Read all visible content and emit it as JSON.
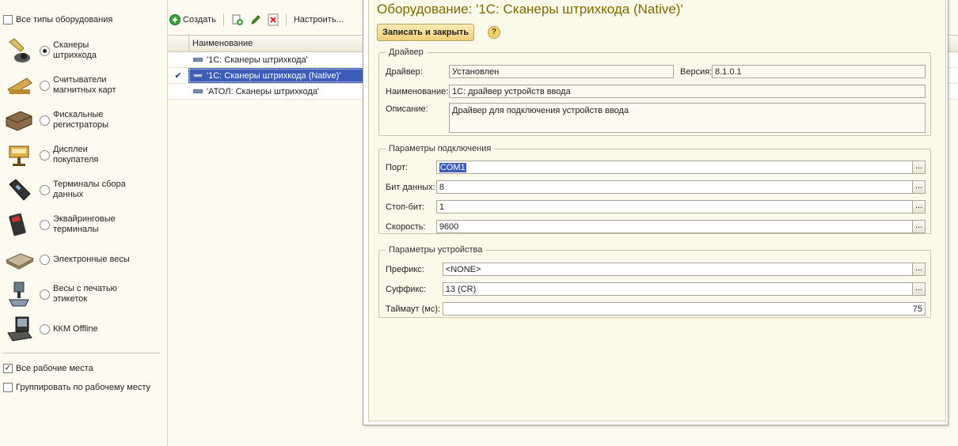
{
  "left": {
    "all_types_label": "Все типы оборудования",
    "types": [
      {
        "label": "Сканеры штрихкода",
        "icon": "barcode-scanner-icon",
        "selected": true
      },
      {
        "label": "Считыватели магнитных карт",
        "icon": "magnetic-card-reader-icon",
        "selected": false
      },
      {
        "label": "Фискальные регистраторы",
        "icon": "fiscal-register-icon",
        "selected": false
      },
      {
        "label": "Дисплеи покупателя",
        "icon": "customer-display-icon",
        "selected": false
      },
      {
        "label": "Терминалы сбора данных",
        "icon": "data-terminal-icon",
        "selected": false
      },
      {
        "label": "Эквайринговые терминалы",
        "icon": "acquiring-terminal-icon",
        "selected": false
      },
      {
        "label": "Электронные весы",
        "icon": "electronic-scales-icon",
        "selected": false
      },
      {
        "label": "Весы с печатью этикеток",
        "icon": "label-scales-icon",
        "selected": false
      },
      {
        "label": "ККМ Offline",
        "icon": "kkm-offline-icon",
        "selected": false
      }
    ],
    "all_workplaces_label": "Все рабочие места",
    "group_by_workplace_label": "Группировать по рабочему месту"
  },
  "toolbar": {
    "create_label": "Создать",
    "configure_label": "Настроить..."
  },
  "grid": {
    "column_name": "Наименование",
    "rows": [
      {
        "name": "'1С: Сканеры штрихкода'",
        "selected": false
      },
      {
        "name": "'1С: Сканеры штрихкода (Native)'",
        "selected": true
      },
      {
        "name": "'АТОЛ: Сканеры штрихкода'",
        "selected": false
      }
    ]
  },
  "modal": {
    "title": "Оборудование: '1С: Сканеры штрихкода (Native)'",
    "save_close_label": "Записать и закрыть",
    "help_label": "?",
    "driver_group": {
      "legend": "Драйвер",
      "driver_label": "Драйвер:",
      "driver_value": "Установлен",
      "version_label": "Версия:",
      "version_value": "8.1.0.1",
      "name_label": "Наименование:",
      "name_value": "1С: драйвер устройств ввода",
      "description_label": "Описание:",
      "description_value": "Драйвер для подключения устройств ввода"
    },
    "connection_group": {
      "legend": "Параметры подключения",
      "port_label": "Порт:",
      "port_value": "COM1",
      "data_bits_label": "Бит данных:",
      "data_bits_value": "8",
      "stop_bits_label": "Стоп-бит:",
      "stop_bits_value": "1",
      "speed_label": "Скорость:",
      "speed_value": "9600"
    },
    "device_group": {
      "legend": "Параметры устройства",
      "prefix_label": "Префикс:",
      "prefix_value": "<NONE>",
      "suffix_label": "Суффикс:",
      "suffix_value": "13 (CR)",
      "timeout_label": "Таймаут (мс):",
      "timeout_value": "75"
    },
    "ellipsis": "..."
  }
}
